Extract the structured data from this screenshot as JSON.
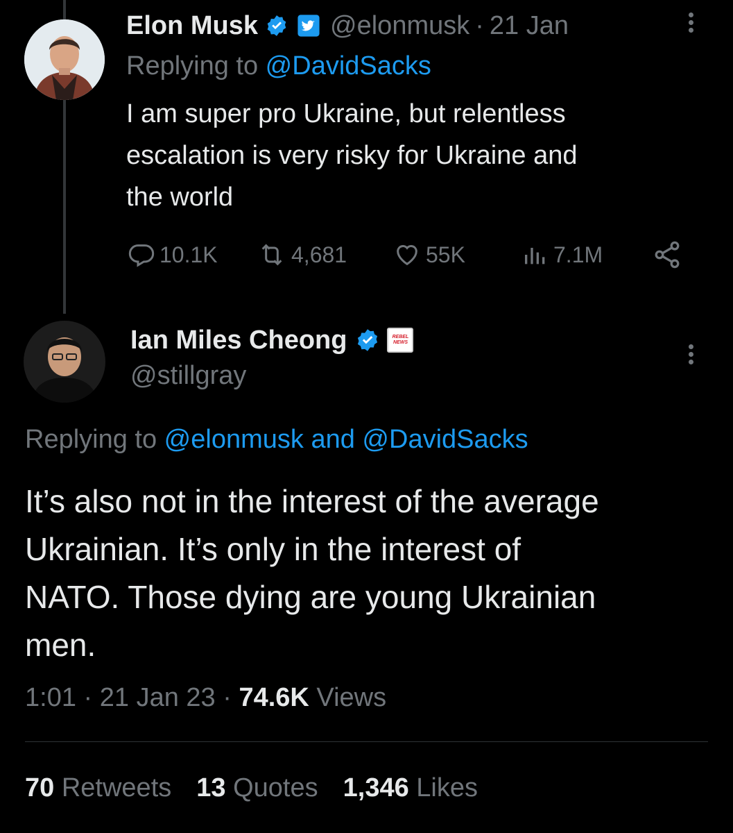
{
  "parent": {
    "name": "Elon Musk",
    "handle": "@elonmusk",
    "separator": "·",
    "date": "21 Jan",
    "replying_prefix": "Replying to ",
    "replying_to": "@DavidSacks",
    "text_lines": [
      "I am super pro Ukraine, but relentless",
      "escalation is very risky for Ukraine and",
      "the world"
    ],
    "actions": {
      "replies": "10.1K",
      "retweets": "4,681",
      "likes": "55K",
      "views": "7.1M"
    }
  },
  "main": {
    "name": "Ian Miles Cheong",
    "badge_text": "REBEL NEWS",
    "handle": "@stillgray",
    "replying_prefix": "Replying to ",
    "replying_to_1": "@elonmusk",
    "replying_and": " and ",
    "replying_to_2": "@DavidSacks",
    "text_lines": [
      "It’s also not in the interest of the average",
      "Ukrainian. It’s only in the interest of",
      "NATO. Those dying are young Ukrainian",
      "men."
    ],
    "time": "1:01",
    "sep1": "·",
    "date": "21 Jan 23",
    "sep2": "·",
    "views_count": "74.6K",
    "views_label": "Views"
  },
  "stats": {
    "retweets_count": "70",
    "retweets_label": "Retweets",
    "quotes_count": "13",
    "quotes_label": "Quotes",
    "likes_count": "1,346",
    "likes_label": "Likes"
  },
  "colors": {
    "background": "#000000",
    "text": "#e7e9ea",
    "muted": "#71767b",
    "accent": "#1d9bf0",
    "divider": "#2f3336"
  }
}
